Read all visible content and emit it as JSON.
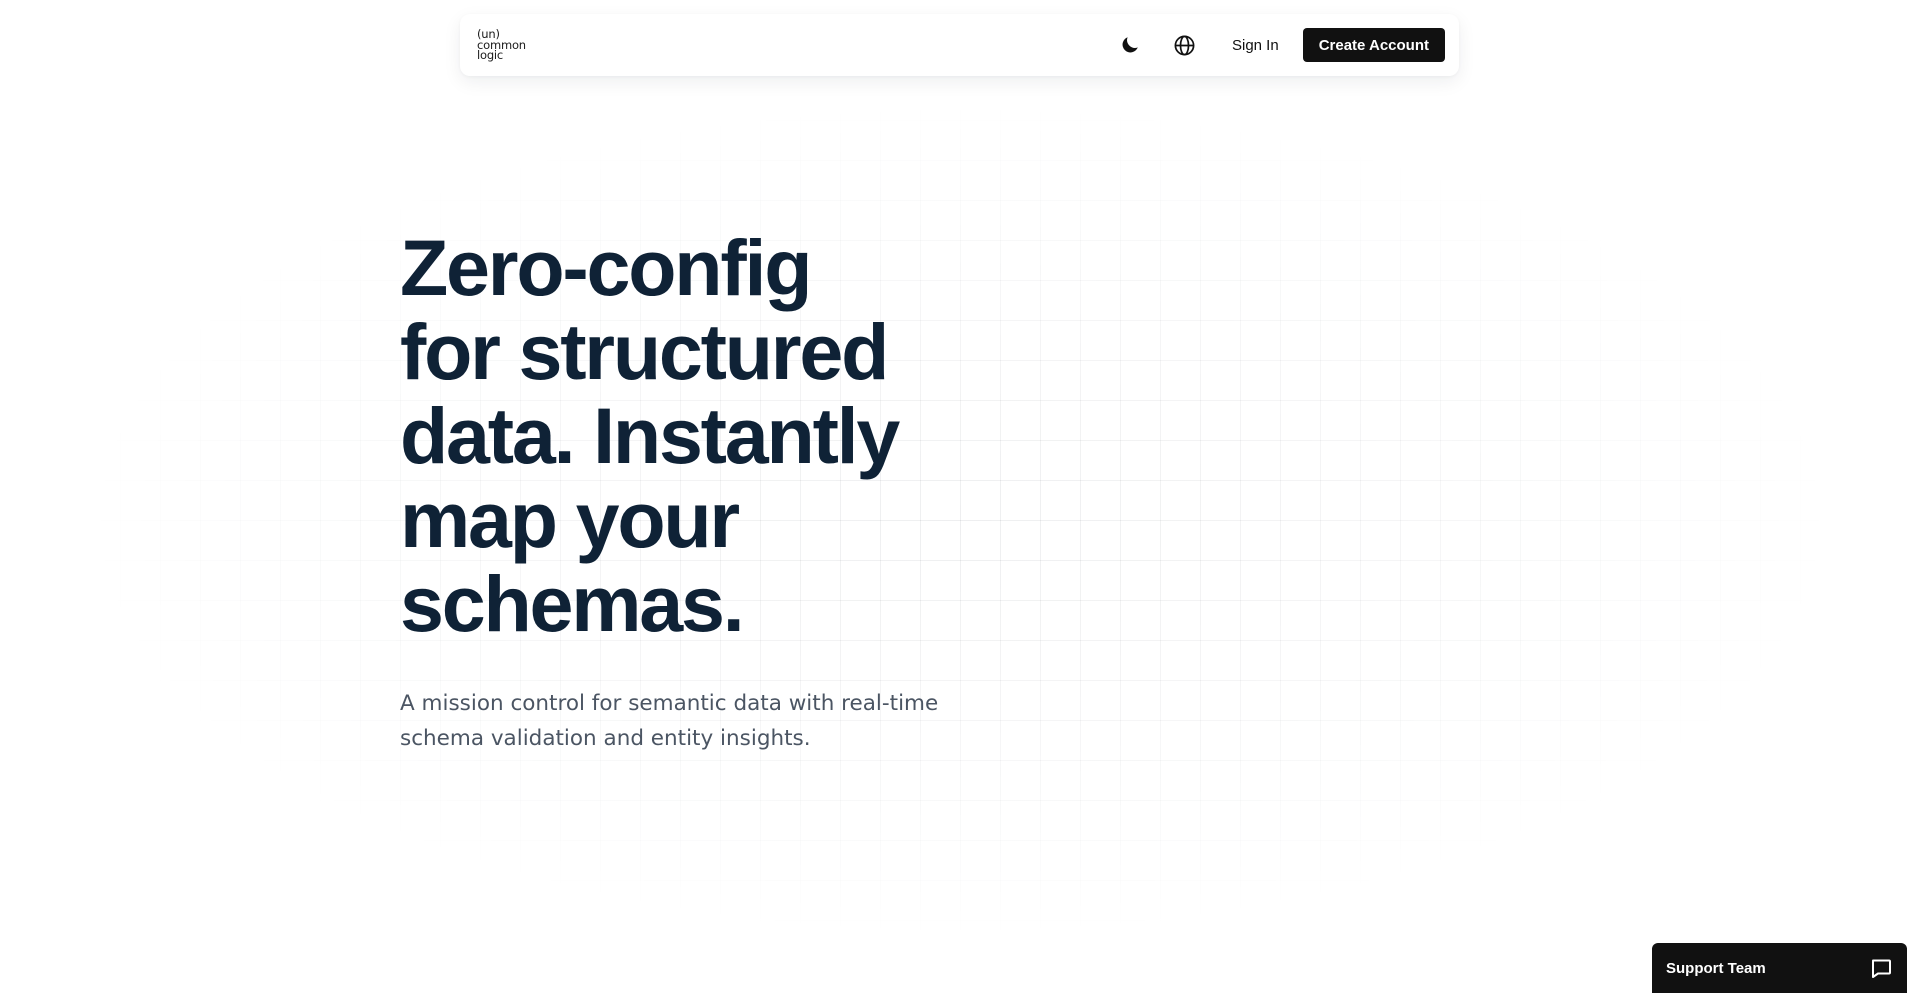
{
  "header": {
    "logo": {
      "line1": "(un)",
      "line2": "common",
      "line3": "logic"
    },
    "theme_icon": "moon-icon",
    "language_icon": "globe-icon",
    "sign_in_label": "Sign In",
    "create_account_label": "Create Account"
  },
  "hero": {
    "title_lines": [
      "Zero-config",
      "for structured",
      "data. Instantly",
      "map your",
      "schemas."
    ],
    "subtitle_line1": "A mission control for semantic data with real-time",
    "subtitle_line2": "schema validation and entity insights."
  },
  "support": {
    "label": "Support Team",
    "icon": "chat-bubble-icon"
  },
  "colors": {
    "title": "#0f2236",
    "subtitle": "#4b5563",
    "button_bg": "#111111",
    "button_text": "#ffffff",
    "page_bg": "#ffffff"
  }
}
